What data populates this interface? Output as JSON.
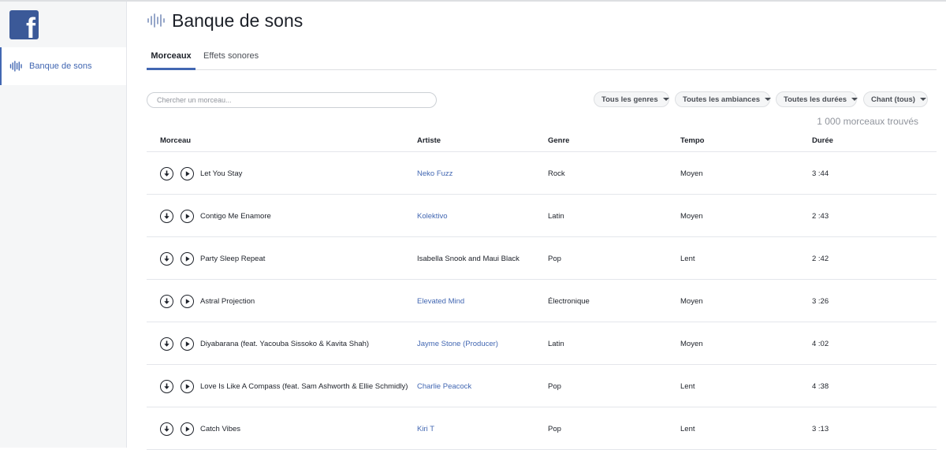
{
  "app": {
    "logo_letter": "f"
  },
  "sidebar": {
    "items": [
      {
        "label": "Banque de sons"
      }
    ]
  },
  "header": {
    "title": "Banque de sons"
  },
  "tabs": [
    {
      "label": "Morceaux"
    },
    {
      "label": "Effets sonores"
    }
  ],
  "search": {
    "placeholder": "Chercher un morceau...",
    "value": ""
  },
  "filters": [
    {
      "label": "Tous les genres"
    },
    {
      "label": "Toutes les ambiances"
    },
    {
      "label": "Toutes les durées"
    },
    {
      "label": "Chant (tous)"
    }
  ],
  "results_count": "1 000 morceaux trouvés",
  "table": {
    "columns": [
      "Morceau",
      "Artiste",
      "Genre",
      "Tempo",
      "Durée"
    ],
    "rows": [
      {
        "title": "Let You Stay",
        "artist": "Neko Fuzz",
        "genre": "Rock",
        "tempo": "Moyen",
        "duration": "3 :44"
      },
      {
        "title": "Contigo Me Enamore",
        "artist": "Kolektivo",
        "genre": "Latin",
        "tempo": "Moyen",
        "duration": "2 :43"
      },
      {
        "title": "Party Sleep Repeat",
        "artist": "Isabella Snook and Maui Black",
        "genre": "Pop",
        "tempo": "Lent",
        "duration": "2 :42"
      },
      {
        "title": "Astral Projection",
        "artist": "Elevated Mind",
        "genre": "Électronique",
        "tempo": "Moyen",
        "duration": "3 :26"
      },
      {
        "title": "Diyabarana (feat. Yacouba Sissoko & Kavita Shah)",
        "artist": "Jayme Stone (Producer)",
        "genre": "Latin",
        "tempo": "Moyen",
        "duration": "4 :02"
      },
      {
        "title": "Love Is Like A Compass (feat. Sam Ashworth & Ellie Schmidly)",
        "artist": "Charlie Peacock",
        "genre": "Pop",
        "tempo": "Lent",
        "duration": "4 :38"
      },
      {
        "title": "Catch Vibes",
        "artist": "Kiri T",
        "genre": "Pop",
        "tempo": "Lent",
        "duration": "3 :13"
      }
    ]
  },
  "colors": {
    "brand": "#3b5998",
    "link": "#4267b2",
    "sidebar_bg": "#f5f6f7"
  },
  "icons": {
    "track_download": "download-icon",
    "track_play": "play-icon",
    "section": "sound-wave-icon"
  }
}
